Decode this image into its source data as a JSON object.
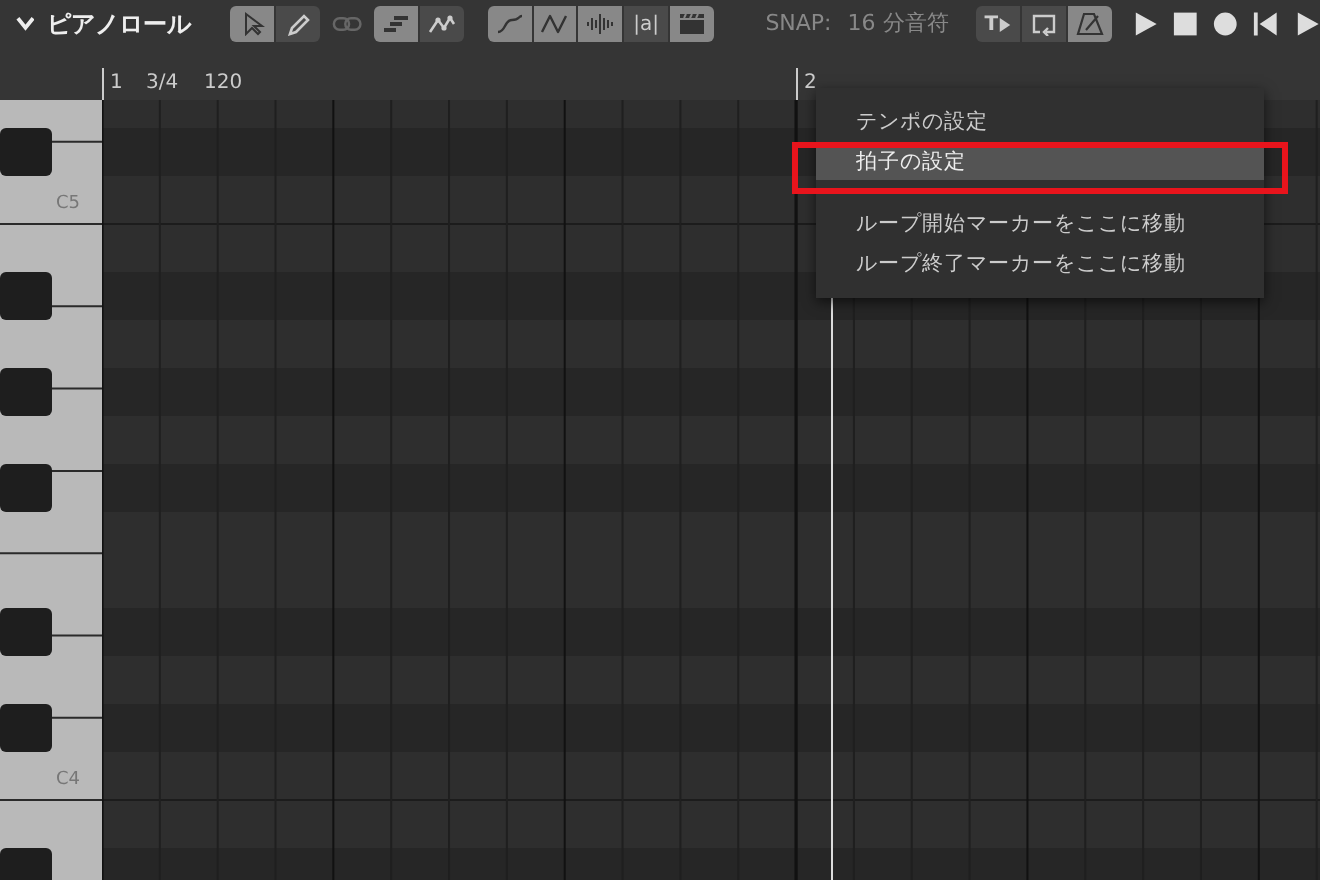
{
  "panel": {
    "title": "ピアノロール"
  },
  "tool_groups": [
    [
      {
        "kind": "cursor",
        "selected": true
      },
      {
        "kind": "pencil",
        "selected": false
      }
    ],
    [
      {
        "kind": "notes",
        "selected": true
      },
      {
        "kind": "automation",
        "selected": false
      }
    ],
    [
      {
        "kind": "curve",
        "selected": true
      },
      {
        "kind": "zigzag",
        "selected": true
      },
      {
        "kind": "waveform",
        "selected": true
      },
      {
        "kind": "text",
        "label": "|a|",
        "selected": false
      },
      {
        "kind": "clapper",
        "selected": true
      }
    ]
  ],
  "link_toggle": {
    "disabled": true
  },
  "snap": {
    "label": "SNAP:",
    "value": "16 分音符"
  },
  "transport_toggles": [
    {
      "kind": "text",
      "label": "T",
      "selected": false
    },
    {
      "kind": "loop",
      "selected": false
    },
    {
      "kind": "metronome",
      "selected": true
    }
  ],
  "transport_buttons": [
    {
      "kind": "play"
    },
    {
      "kind": "stop"
    },
    {
      "kind": "record"
    },
    {
      "kind": "skip-back"
    },
    {
      "kind": "play"
    }
  ],
  "ruler": [
    {
      "kind": "bar",
      "label": "1"
    },
    {
      "kind": "text",
      "label": "3/4"
    },
    {
      "kind": "text",
      "label": "120"
    },
    {
      "kind": "bar",
      "label": "2"
    }
  ],
  "keyboard": {
    "labels": [
      "C5",
      "C4"
    ]
  },
  "context_menu": {
    "items": [
      {
        "label": "テンポの設定",
        "selected": false,
        "callout": false
      },
      {
        "label": "拍子の設定",
        "selected": true,
        "callout": true
      },
      {
        "kind": "separator"
      },
      {
        "label": "ループ開始マーカーをここに移動",
        "selected": false,
        "callout": false
      },
      {
        "label": "ループ終了マーカーをここに移動",
        "selected": false,
        "callout": false
      }
    ]
  }
}
